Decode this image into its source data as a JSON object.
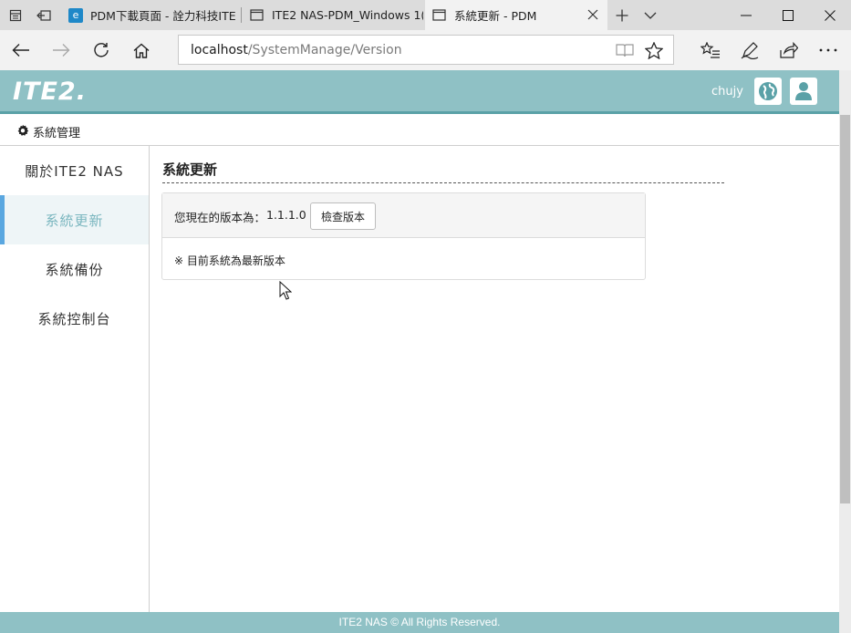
{
  "browser": {
    "tabs": [
      {
        "label": "PDM下載頁面 - 詮力科技ITE",
        "icon": "edge-page-icon"
      },
      {
        "label": "ITE2 NAS-PDM_Windows 1(",
        "icon": "page-icon"
      },
      {
        "label": "系統更新 - PDM",
        "icon": "page-icon",
        "active": true
      }
    ],
    "address": {
      "host": "localhost",
      "path": "/SystemManage/Version"
    }
  },
  "header": {
    "logo_text": "ITE2.",
    "username": "chujy",
    "colors": {
      "header_bg": "#8fc1c5",
      "header_border": "#5aa1a7"
    }
  },
  "breadcrumb": {
    "icon": "gear-icon",
    "label": "系統管理"
  },
  "sidebar": {
    "items": [
      {
        "label": "關於ITE2 NAS"
      },
      {
        "label": "系統更新",
        "active": true
      },
      {
        "label": "系統備份"
      },
      {
        "label": "系統控制台"
      }
    ],
    "active_color": "#7ab6bf",
    "indicator_color": "#5aa7e0"
  },
  "main": {
    "title": "系統更新",
    "version_label": "您現在的版本為：",
    "version_value": "1.1.1.0",
    "check_button": "檢查版本",
    "status_message": "※ 目前系統為最新版本"
  },
  "footer": {
    "text": "ITE2 NAS © All Rights Reserved."
  }
}
